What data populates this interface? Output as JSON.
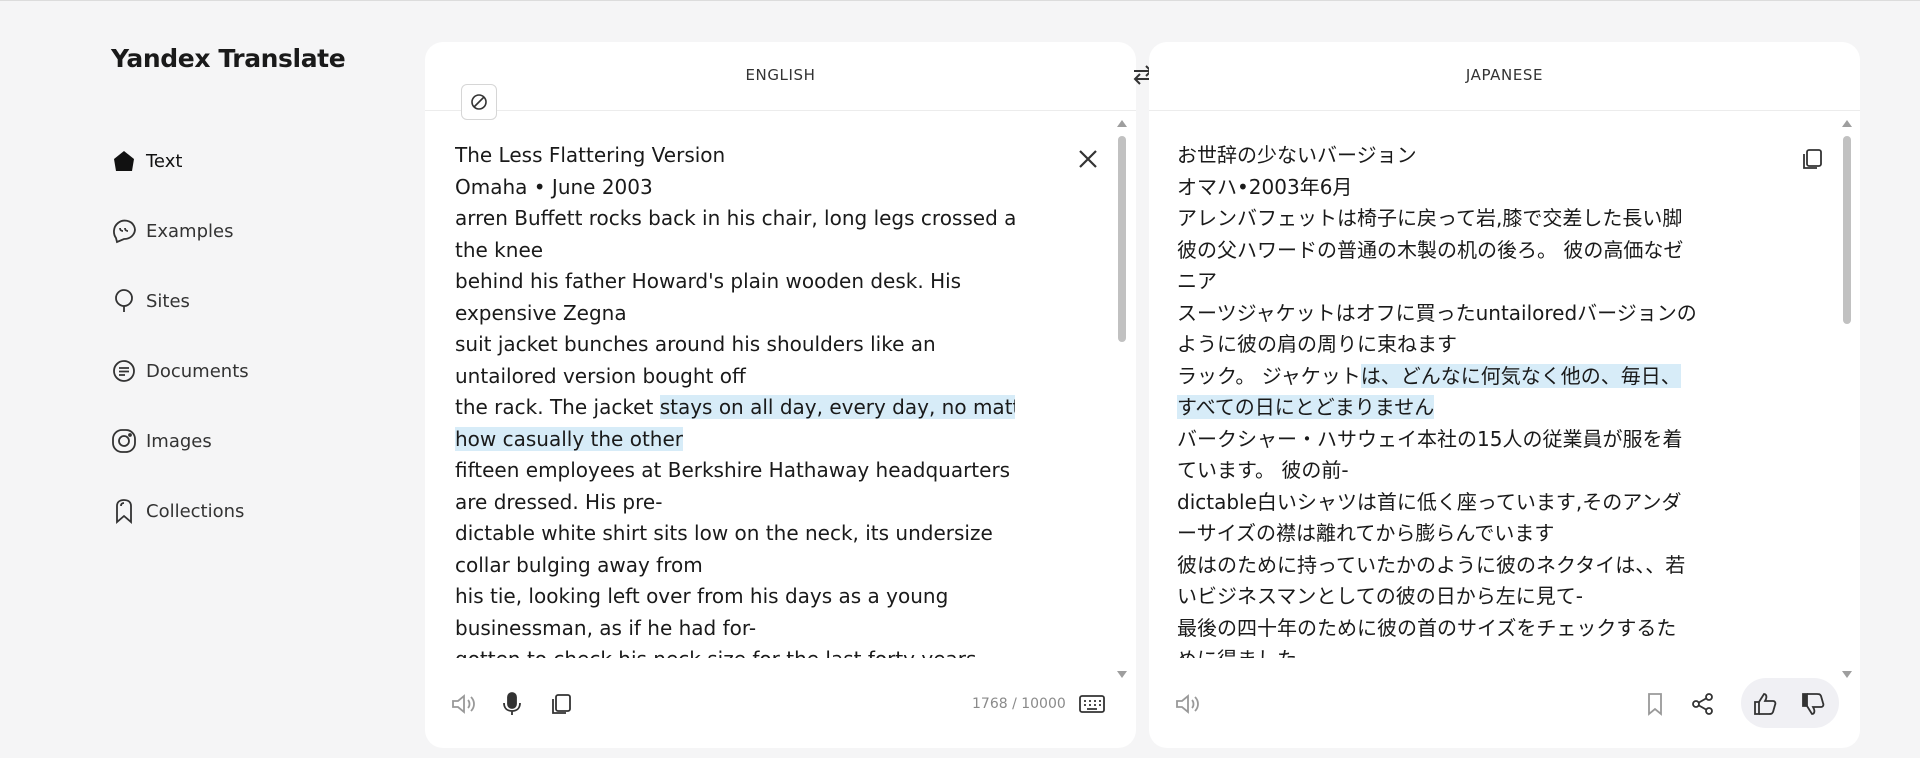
{
  "app": {
    "title": "Yandex Translate"
  },
  "sidebar": {
    "items": [
      {
        "label": "Text",
        "icon": "home-icon",
        "active": true
      },
      {
        "label": "Examples",
        "icon": "chat-bubbles-icon"
      },
      {
        "label": "Sites",
        "icon": "bulb-icon"
      },
      {
        "label": "Documents",
        "icon": "document-icon"
      },
      {
        "label": "Images",
        "icon": "camera-icon"
      },
      {
        "label": "Collections",
        "icon": "bookmark-icon"
      }
    ]
  },
  "source": {
    "language": "ENGLISH",
    "lines": [
      [
        {
          "t": "The Less Flattering Version"
        }
      ],
      [
        {
          "t": "Omaha • June 2003"
        }
      ],
      [
        {
          "t": "arren Buffett rocks back in his chair, long legs crossed at"
        }
      ],
      [
        {
          "t": "the knee"
        }
      ],
      [
        {
          "t": "behind his father Howard's plain wooden desk. His"
        }
      ],
      [
        {
          "t": "expensive Zegna"
        }
      ],
      [
        {
          "t": "suit jacket bunches around his shoulders like an"
        }
      ],
      [
        {
          "t": "untailored version bought off"
        }
      ],
      [
        {
          "t": "the rack. The jacket "
        },
        {
          "t": "stays on all day, every day, no matter",
          "hl": true
        }
      ],
      [
        {
          "t": "how casually the other",
          "hl": true
        }
      ],
      [
        {
          "t": "fifteen employees at Berkshire Hathaway headquarters"
        }
      ],
      [
        {
          "t": "are dressed. His pre-"
        }
      ],
      [
        {
          "t": "dictable white shirt sits low on the neck, its undersize"
        }
      ],
      [
        {
          "t": "collar bulging away from"
        }
      ],
      [
        {
          "t": "his tie, looking left over from his days as a young"
        }
      ],
      [
        {
          "t": "businessman, as if he had for-"
        }
      ],
      [
        {
          "t": "gotten to check his neck size for the last forty years."
        }
      ]
    ],
    "char_count": "1768 / 10000"
  },
  "target": {
    "language": "JAPANESE",
    "lines": [
      [
        {
          "t": "お世辞の少ないバージョン"
        }
      ],
      [
        {
          "t": "オマハ•2003年6月"
        }
      ],
      [
        {
          "t": "アレンバフェットは椅子に戻って岩,膝で交差した長い脚"
        }
      ],
      [
        {
          "t": "彼の父ハワードの普通の木製の机の後ろ。 彼の高価なゼ"
        }
      ],
      [
        {
          "t": "ニア"
        }
      ],
      [
        {
          "t": "スーツジャケットはオフに買ったuntailoredバージョンの"
        }
      ],
      [
        {
          "t": "ように彼の肩の周りに束ねます"
        }
      ],
      [
        {
          "t": "ラック。 ジャケット"
        },
        {
          "t": "は、どんなに何気なく他の、毎日、",
          "hl": true
        }
      ],
      [
        {
          "t": "すべての日にとどまりません",
          "hl": true
        }
      ],
      [
        {
          "t": "バークシャー・ハサウェイ本社の15人の従業員が服を着"
        }
      ],
      [
        {
          "t": "ています。 彼の前-"
        }
      ],
      [
        {
          "t": "dictable白いシャツは首に低く座っています,そのアンダ"
        }
      ],
      [
        {
          "t": "ーサイズの襟は離れてから膨らんでいます"
        }
      ],
      [
        {
          "t": "彼はのために持っていたかのように彼のネクタイは、、若"
        }
      ],
      [
        {
          "t": "いビジネスマンとしての彼の日から左に見て-"
        }
      ],
      [
        {
          "t": "最後の四十年のために彼の首のサイズをチェックするた"
        }
      ],
      [
        {
          "t": "めに得ました"
        }
      ]
    ]
  },
  "colors": {
    "highlight": "#d7ecf8",
    "background": "#f5f5f6",
    "panel": "#ffffff"
  }
}
